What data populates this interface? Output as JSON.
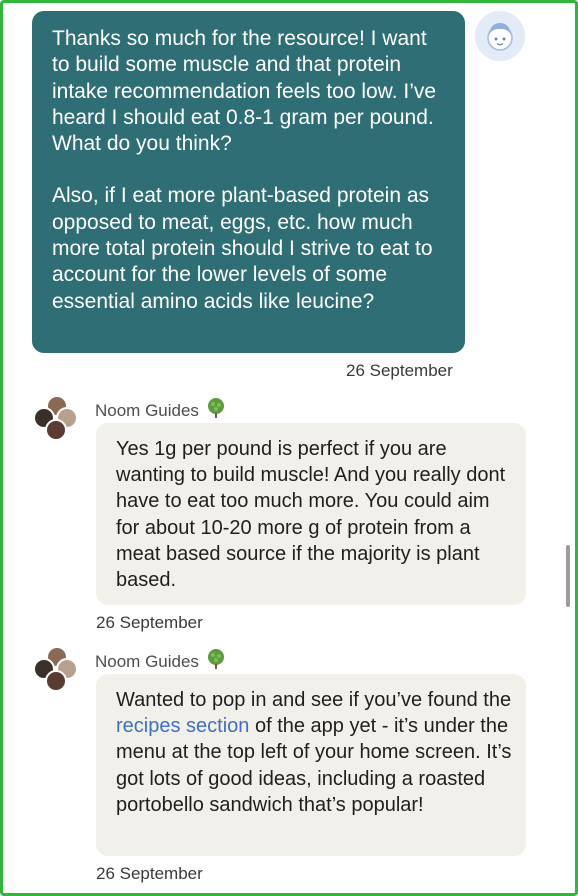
{
  "colors": {
    "accent": "#2fb63b",
    "user_bubble": "#2f6e74",
    "guide_bubble": "#f2f0eb",
    "link": "#3f6fc4"
  },
  "messages": {
    "user": {
      "paragraph_1": "Thanks so much for the resource! I want to build some muscle and that protein intake recommendation feels too low. I’ve heard I should eat 0.8-1 gram per pound. What do you think?",
      "paragraph_2": "Also, if I eat more plant-based protein as opposed to meat, eggs, etc. how much more total protein should I strive to eat to account for the lower levels of some essential amino acids like leucine?",
      "timestamp": "26 September",
      "avatar_icon": "user-face-icon"
    },
    "guide_1": {
      "sender": "Noom Guides",
      "sender_icon": "tree-icon",
      "text": "Yes 1g per pound is perfect if you are wanting to build muscle! And you really dont have to eat too much more. You could aim for about 10-20 more g of protein from a meat based source if the majority is plant based.",
      "timestamp": "26 September"
    },
    "guide_2": {
      "sender": "Noom Guides",
      "sender_icon": "tree-icon",
      "text_before": "Wanted to pop in and see if you’ve found the ",
      "link_text": "recipes section",
      "text_after": " of the app yet - it’s under the menu at the top left of your home screen. It’s got lots of good ideas, including a roasted portobello sandwich that’s popular!",
      "timestamp": "26 September"
    }
  }
}
